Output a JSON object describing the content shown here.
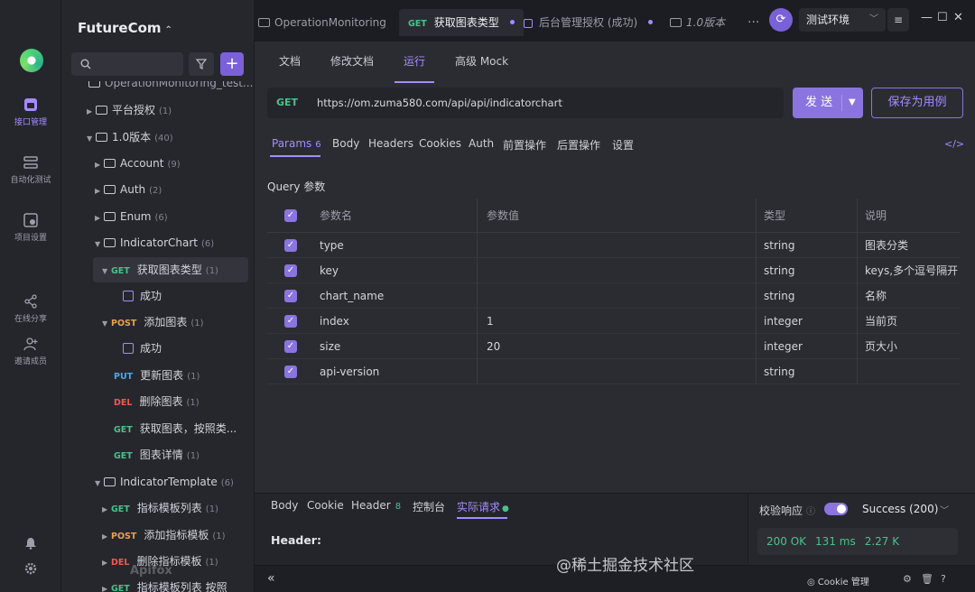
{
  "rail": {
    "items": [
      {
        "label": "接口管理"
      },
      {
        "label": "自动化测试"
      },
      {
        "label": "项目设置"
      },
      {
        "label": "在线分享"
      },
      {
        "label": "邀请成员"
      }
    ]
  },
  "tree": {
    "project": "FutureCom",
    "rows": [
      {
        "text": "OperationMonitoring_test...",
        "count": ""
      },
      {
        "text": "平台授权",
        "count": "(1)"
      },
      {
        "text": "1.0版本",
        "count": "(40)"
      },
      {
        "text": "Account",
        "count": "(9)"
      },
      {
        "text": "Auth",
        "count": "(2)"
      },
      {
        "text": "Enum",
        "count": "(6)"
      },
      {
        "text": "IndicatorChart",
        "count": "(6)"
      },
      {
        "method": "GET",
        "text": "获取图表类型",
        "count": "(1)"
      },
      {
        "text": "成功",
        "count": ""
      },
      {
        "method": "POST",
        "text": "添加图表",
        "count": "(1)"
      },
      {
        "text": "成功",
        "count": ""
      },
      {
        "method": "PUT",
        "text": "更新图表",
        "count": "(1)"
      },
      {
        "method": "DEL",
        "text": "删除图表",
        "count": "(1)"
      },
      {
        "method": "GET",
        "text": "获取图表，按照类...",
        "count": ""
      },
      {
        "method": "GET",
        "text": "图表详情",
        "count": "(1)"
      },
      {
        "text": "IndicatorTemplate",
        "count": "(6)"
      },
      {
        "method": "GET",
        "text": "指标模板列表",
        "count": "(1)"
      },
      {
        "method": "POST",
        "text": "添加指标模板",
        "count": "(1)"
      },
      {
        "method": "DEL",
        "text": "删除指标模板",
        "count": "(1)"
      },
      {
        "method": "GET",
        "text": "指标模板列表 按照",
        "count": ""
      }
    ],
    "apifox": "Apifox"
  },
  "tabs": {
    "t1": "OperationMonitoring",
    "t2_method": "GET",
    "t2": "获取图表类型",
    "t3": "后台管理授权 (成功)",
    "t4": "1.0版本",
    "more": "···",
    "env": "测试环境"
  },
  "main": {
    "subtabs": [
      "文档",
      "修改文档",
      "运行",
      "高级 Mock"
    ],
    "method": "GET",
    "url": "https://om.zuma580.com/api/api/indicatorchart",
    "send": "发 送",
    "save": "保存为用例",
    "param_tabs": [
      "Params",
      "Body",
      "Headers",
      "Cookies",
      "Auth",
      "前置操作",
      "后置操作",
      "设置"
    ],
    "params_count": "6",
    "code_icon": "</>",
    "query_label": "Query 参数",
    "table": {
      "headers": [
        "参数名",
        "参数值",
        "类型",
        "说明"
      ],
      "rows": [
        {
          "name": "type",
          "value": "",
          "type": "string",
          "desc": "图表分类"
        },
        {
          "name": "key",
          "value": "",
          "type": "string",
          "desc": "keys,多个逗号隔开"
        },
        {
          "name": "chart_name",
          "value": "",
          "type": "string",
          "desc": "名称"
        },
        {
          "name": "index",
          "value": "1",
          "type": "integer",
          "desc": "当前页"
        },
        {
          "name": "size",
          "value": "20",
          "type": "integer",
          "desc": "页大小"
        },
        {
          "name": "api-version",
          "value": "",
          "type": "string",
          "desc": ""
        }
      ]
    }
  },
  "bottom": {
    "tabs": [
      "Body",
      "Cookie",
      "Header",
      "控制台",
      "实际请求"
    ],
    "header_count": "8",
    "header_label": "Header:",
    "validate": "校验响应",
    "success": "Success (200)",
    "status": "200 OK",
    "time": "131 ms",
    "size": "2.27 K"
  },
  "statusbar": {
    "collapse": "«",
    "cookie": "Cookie 管理"
  },
  "watermark": "@稀土掘金技术社区"
}
